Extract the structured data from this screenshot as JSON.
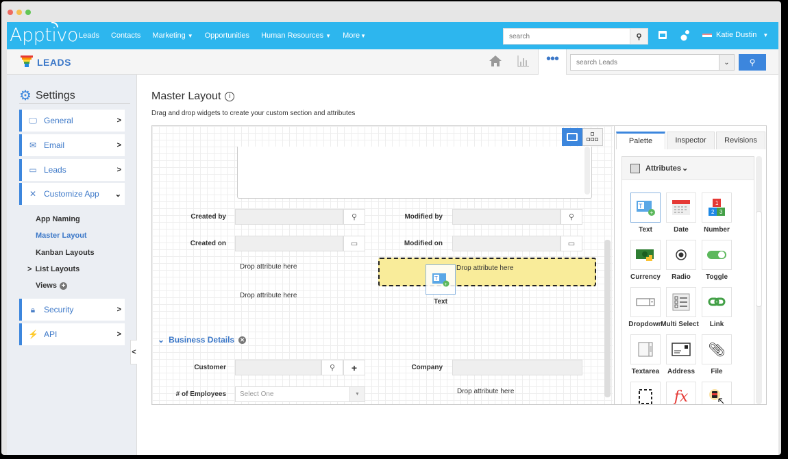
{
  "window": {
    "controls": [
      "close",
      "minimize",
      "maximize"
    ]
  },
  "topnav": {
    "logo": "Apptivo",
    "links": [
      {
        "label": "Leads",
        "dropdown": false
      },
      {
        "label": "Contacts",
        "dropdown": false
      },
      {
        "label": "Marketing",
        "dropdown": true
      },
      {
        "label": "Opportunities",
        "dropdown": false
      },
      {
        "label": "Human Resources",
        "dropdown": true
      },
      {
        "label": "More",
        "dropdown": true
      }
    ],
    "search_placeholder": "search",
    "user_name": "Katie Dustin",
    "brand_color": "#2db6ee"
  },
  "subheader": {
    "app_title": "LEADS",
    "search_placeholder": "search Leads",
    "icons": [
      "home-icon",
      "reports-icon",
      "more-icon"
    ]
  },
  "sidebar": {
    "title": "Settings",
    "items": [
      {
        "label": "General",
        "icon": "monitor-icon",
        "expanded": false
      },
      {
        "label": "Email",
        "icon": "envelope-icon",
        "expanded": false
      },
      {
        "label": "Leads",
        "icon": "window-icon",
        "expanded": false
      },
      {
        "label": "Customize App",
        "icon": "tools-icon",
        "expanded": true
      },
      {
        "label": "Security",
        "icon": "lock-icon",
        "expanded": false
      },
      {
        "label": "API",
        "icon": "plug-icon",
        "expanded": false
      }
    ],
    "sub_items": [
      {
        "label": "App Naming",
        "active": false
      },
      {
        "label": "Master Layout",
        "active": true
      },
      {
        "label": "Kanban Layouts",
        "active": false
      },
      {
        "label": "List Layouts",
        "active": false,
        "has_children": true
      },
      {
        "label": "Views",
        "active": false,
        "add": true
      }
    ]
  },
  "main": {
    "title": "Master Layout",
    "subtitle": "Drag and drop widgets to create your custom section and attributes",
    "fields": {
      "created_by": "Created by",
      "created_on": "Created on",
      "modified_by": "Modified by",
      "modified_on": "Modified on",
      "customer": "Customer",
      "employees": "# of Employees",
      "company": "Company"
    },
    "employees_placeholder": "Select One",
    "drop_text": "Drop attribute here",
    "drag_widget_label": "Text",
    "section_title": "Business Details"
  },
  "palette": {
    "tabs": [
      "Palette",
      "Inspector",
      "Revisions"
    ],
    "active_tab": "Palette",
    "group_title": "Attributes",
    "widgets": [
      {
        "label": "Text",
        "icon": "text-field-icon"
      },
      {
        "label": "Date",
        "icon": "calendar-icon"
      },
      {
        "label": "Number",
        "icon": "number-blocks-icon"
      },
      {
        "label": "Currency",
        "icon": "money-icon"
      },
      {
        "label": "Radio",
        "icon": "radio-icon"
      },
      {
        "label": "Toggle",
        "icon": "toggle-icon"
      },
      {
        "label": "Dropdown",
        "icon": "dropdown-icon"
      },
      {
        "label": "Multi Select",
        "icon": "checklist-icon"
      },
      {
        "label": "Link",
        "icon": "link-icon"
      },
      {
        "label": "Textarea",
        "icon": "textarea-icon"
      },
      {
        "label": "Address",
        "icon": "address-card-icon"
      },
      {
        "label": "File",
        "icon": "paperclip-icon"
      },
      {
        "label": "",
        "icon": "section-icon"
      },
      {
        "label": "",
        "icon": "formula-icon"
      },
      {
        "label": "",
        "icon": "reference-icon"
      }
    ]
  }
}
